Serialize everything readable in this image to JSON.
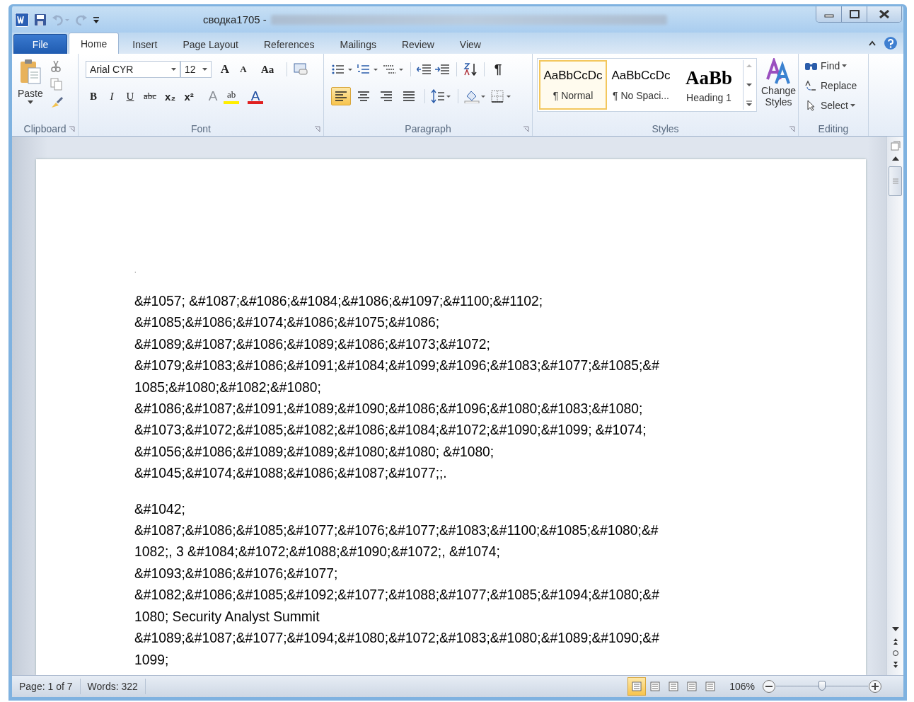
{
  "window": {
    "title": "сводка1705 -"
  },
  "tabs": [
    {
      "label": "File",
      "kind": "file",
      "selected": false
    },
    {
      "label": "Home",
      "kind": "tab",
      "selected": true
    },
    {
      "label": "Insert",
      "kind": "tab",
      "selected": false
    },
    {
      "label": "Page Layout",
      "kind": "tab",
      "selected": false
    },
    {
      "label": "References",
      "kind": "tab",
      "selected": false
    },
    {
      "label": "Mailings",
      "kind": "tab",
      "selected": false
    },
    {
      "label": "Review",
      "kind": "tab",
      "selected": false
    },
    {
      "label": "View",
      "kind": "tab",
      "selected": false
    }
  ],
  "clipboard": {
    "paste": "Paste",
    "label": "Clipboard"
  },
  "font": {
    "name": "Arial CYR",
    "size": "12",
    "label": "Font",
    "row1_tools": [
      {
        "glyph": "A",
        "kind": "grow"
      },
      {
        "glyph": "A",
        "kind": "shrink"
      },
      {
        "glyph": "Aa",
        "kind": "case"
      }
    ],
    "row2_tools": [
      {
        "glyph": "B",
        "kind": "bold"
      },
      {
        "glyph": "I",
        "kind": "italic"
      },
      {
        "glyph": "U",
        "kind": "underline"
      },
      {
        "glyph": "abc",
        "kind": "strike"
      },
      {
        "glyph": "x₂",
        "kind": "sub"
      },
      {
        "glyph": "x²",
        "kind": "sup"
      },
      {
        "glyph": "A",
        "kind": "effects"
      },
      {
        "glyph": "ab",
        "kind": "highlight"
      },
      {
        "glyph": "A",
        "kind": "color"
      }
    ]
  },
  "paragraph": {
    "label": "Paragraph",
    "marks": "¶",
    "alignments": [
      {
        "selected": true
      },
      {
        "selected": false
      },
      {
        "selected": false
      },
      {
        "selected": false
      }
    ]
  },
  "styles": {
    "label": "Styles",
    "items": [
      {
        "sample": "AaBbCcDc",
        "name": "¶ Normal",
        "kind": "body",
        "selected": true
      },
      {
        "sample": "AaBbCcDc",
        "name": "¶ No Spaci...",
        "kind": "body",
        "selected": false
      },
      {
        "sample": "AaBb",
        "name": "Heading 1",
        "kind": "heading",
        "selected": false
      }
    ],
    "change": "Change Styles"
  },
  "editing": {
    "label": "Editing",
    "items": [
      {
        "label": "Find",
        "kind": "find"
      },
      {
        "label": "Replace",
        "kind": "replace"
      },
      {
        "label": "Select",
        "kind": "select"
      }
    ]
  },
  "document": {
    "stray": ".",
    "paragraphs": [
      [
        "&#1057; &#1087;&#1086;&#1084;&#1086;&#1097;&#1100;&#1102;",
        "&#1085;&#1086;&#1074;&#1086;&#1075;&#1086;",
        "&#1089;&#1087;&#1086;&#1089;&#1086;&#1073;&#1072;",
        "&#1079;&#1083;&#1086;&#1091;&#1084;&#1099;&#1096;&#1083;&#1077;&#1085;&#",
        "1085;&#1080;&#1082;&#1080;",
        "&#1086;&#1087;&#1091;&#1089;&#1090;&#1086;&#1096;&#1080;&#1083;&#1080;",
        "&#1073;&#1072;&#1085;&#1082;&#1086;&#1084;&#1072;&#1090;&#1099; &#1074;",
        "&#1056;&#1086;&#1089;&#1089;&#1080;&#1080; &#1080;",
        "&#1045;&#1074;&#1088;&#1086;&#1087;&#1077;;."
      ],
      [
        "&#1042;",
        "&#1087;&#1086;&#1085;&#1077;&#1076;&#1077;&#1083;&#1100;&#1085;&#1080;&#",
        "1082;, 3 &#1084;&#1072;&#1088;&#1090;&#1072;, &#1074;",
        "&#1093;&#1086;&#1076;&#1077;",
        "&#1082;&#1086;&#1085;&#1092;&#1077;&#1088;&#1077;&#1085;&#1094;&#1080;&#",
        "1080; Security Analyst Summit",
        "&#1089;&#1087;&#1077;&#1094;&#1080;&#1072;&#1083;&#1080;&#1089;&#1090;&#",
        "1099;"
      ]
    ]
  },
  "status_bar": {
    "page": "Page: 1 of 7",
    "words": "Words: 322",
    "views": [
      {
        "selected": true
      },
      {
        "selected": false
      },
      {
        "selected": false
      },
      {
        "selected": false
      },
      {
        "selected": false
      }
    ],
    "zoom": "106%",
    "zoom_slider": {
      "level": 0.5
    }
  }
}
